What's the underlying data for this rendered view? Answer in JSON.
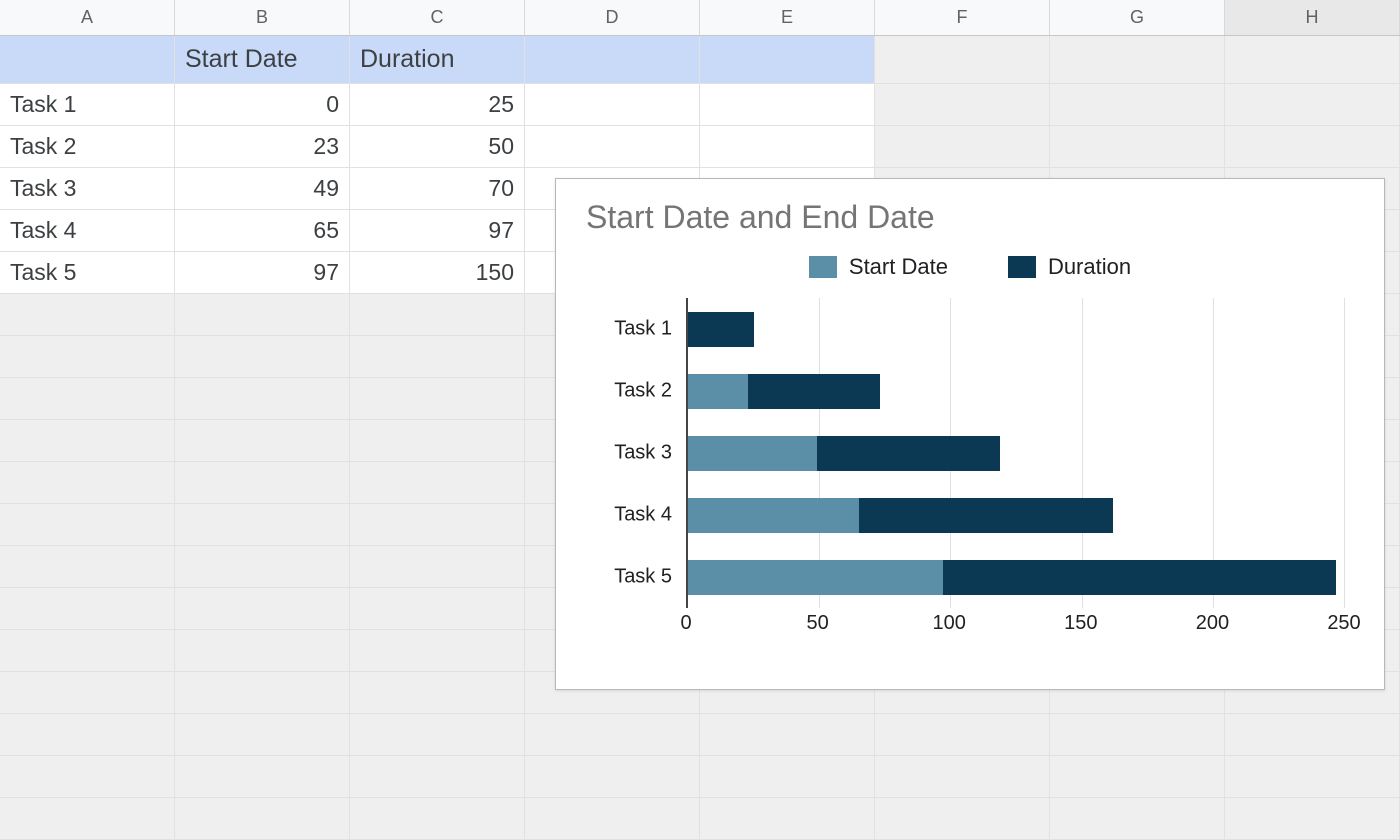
{
  "columns": [
    "A",
    "B",
    "C",
    "D",
    "E",
    "F",
    "G",
    "H"
  ],
  "selected_col_index": 7,
  "selected_col_count": 5,
  "selected_row_count": 5,
  "total_rows": 18,
  "header_row": [
    "",
    "Start Date",
    "Duration",
    "",
    ""
  ],
  "data_rows": [
    {
      "label": "Task 1",
      "start": 0,
      "duration": 25
    },
    {
      "label": "Task 2",
      "start": 23,
      "duration": 50
    },
    {
      "label": "Task 3",
      "start": 49,
      "duration": 70
    },
    {
      "label": "Task 4",
      "start": 65,
      "duration": 97
    },
    {
      "label": "Task 5",
      "start": 97,
      "duration": 150
    }
  ],
  "chart_data": {
    "type": "bar",
    "orientation": "horizontal",
    "stacked": true,
    "title": "Start Date and End Date",
    "categories": [
      "Task 1",
      "Task 2",
      "Task 3",
      "Task 4",
      "Task 5"
    ],
    "series": [
      {
        "name": "Start Date",
        "color": "#5b8fa8",
        "values": [
          0,
          23,
          49,
          65,
          97
        ]
      },
      {
        "name": "Duration",
        "color": "#0b3954",
        "values": [
          25,
          50,
          70,
          97,
          150
        ]
      }
    ],
    "xlabel": "",
    "ylabel": "",
    "xlim": [
      0,
      250
    ],
    "x_ticks": [
      0,
      50,
      100,
      150,
      200,
      250
    ],
    "grid": true,
    "legend_position": "top"
  }
}
